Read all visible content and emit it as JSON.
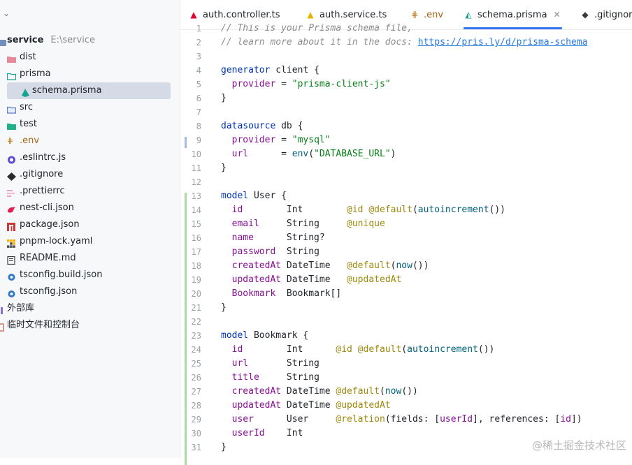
{
  "sidebar": {
    "project_name": "service",
    "project_path": "E:\\service",
    "items": [
      {
        "label": "dist",
        "icon": "folder-red-icon"
      },
      {
        "label": "prisma",
        "icon": "folder-teal-icon"
      },
      {
        "label": "schema.prisma",
        "icon": "prisma-icon"
      },
      {
        "label": "src",
        "icon": "folder-blue-icon"
      },
      {
        "label": "test",
        "icon": "folder-green-icon"
      },
      {
        "label": ".env",
        "icon": "env-icon"
      },
      {
        "label": ".eslintrc.js",
        "icon": "eslint-icon"
      },
      {
        "label": ".gitignore",
        "icon": "git-icon"
      },
      {
        "label": ".prettierrc",
        "icon": "prettier-icon"
      },
      {
        "label": "nest-cli.json",
        "icon": "nest-icon"
      },
      {
        "label": "package.json",
        "icon": "npm-icon"
      },
      {
        "label": "pnpm-lock.yaml",
        "icon": "pnpm-icon"
      },
      {
        "label": "README.md",
        "icon": "markdown-icon"
      },
      {
        "label": "tsconfig.build.json",
        "icon": "tsconfig-icon"
      },
      {
        "label": "tsconfig.json",
        "icon": "tsconfig-icon"
      },
      {
        "label": "外部库",
        "icon": "library-icon"
      },
      {
        "label": "临时文件和控制台",
        "icon": "scratch-icon"
      }
    ]
  },
  "tabs": [
    {
      "label": "auth.controller.ts",
      "icon": "angular-icon",
      "color": "#dd0031"
    },
    {
      "label": "auth.service.ts",
      "icon": "angular-service-icon",
      "color": "#e8b400"
    },
    {
      "label": ".env",
      "icon": "env-icon",
      "color": "#c87b1e"
    },
    {
      "label": "schema.prisma",
      "icon": "prisma-icon",
      "color": "#16a394"
    },
    {
      "label": ".gitignore",
      "icon": "git-icon",
      "color": "#3a3a3a"
    }
  ],
  "active_tab": "schema.prisma",
  "code": {
    "first_line_number": 1,
    "last_line_number": 31,
    "docs_link": "https://pris.ly/d/prisma-schema"
  },
  "watermark": "@稀土掘金技术社区",
  "colors": {
    "accent": "#3574f0",
    "keyword": "#0033b3",
    "string": "#067d17",
    "field": "#871094",
    "annotation": "#9e880d"
  }
}
